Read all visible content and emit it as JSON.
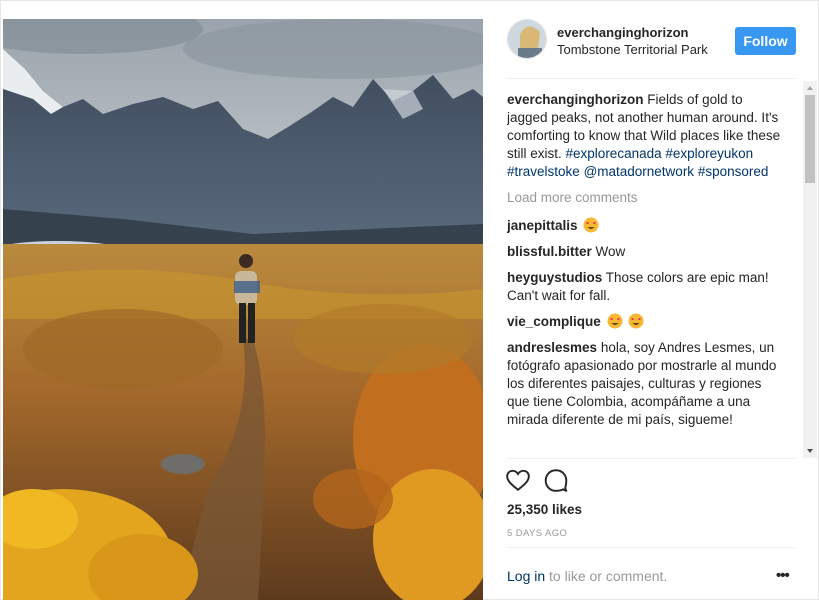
{
  "post": {
    "username": "everchanginghorizon",
    "location": "Tombstone Territorial Park",
    "follow_label": "Follow",
    "caption": {
      "text": "Fields of gold to jagged peaks, not another human around. It's comforting to know that Wild places like these still exist.",
      "tags": [
        "#explorecanada",
        "#exploreyukon",
        "#travelstoke",
        "@matadornetwork",
        "#sponsored"
      ]
    },
    "load_more": "Load more comments",
    "comments": [
      {
        "user": "janepittalis",
        "text": "",
        "emoji": 1
      },
      {
        "user": "blissful.bitter",
        "text": "Wow",
        "emoji": 0
      },
      {
        "user": "heyguystudios",
        "text": "Those colors are epic man! Can't wait for fall.",
        "emoji": 0
      },
      {
        "user": "vie_complique",
        "text": "",
        "emoji": 2
      },
      {
        "user": "andreslesmes",
        "text": "hola, soy Andres Lesmes, un fotógrafo apasionado por mostrarle al mundo los diferentes paisajes, culturas y regiones que tiene Colombia, acompáñame a una mirada diferente de mi país, sigueme!",
        "emoji": 0
      }
    ],
    "likes": "25,350 likes",
    "time_ago": "5 DAYS AGO",
    "login_link": "Log in",
    "login_suffix": " to like or comment.",
    "more_label": "•••",
    "icons": {
      "like": "heart-icon",
      "comment": "comment-bubble-icon",
      "options": "more-options-icon"
    },
    "colors": {
      "follow": "#3897f0",
      "link": "#003569",
      "muted": "#999999"
    }
  }
}
